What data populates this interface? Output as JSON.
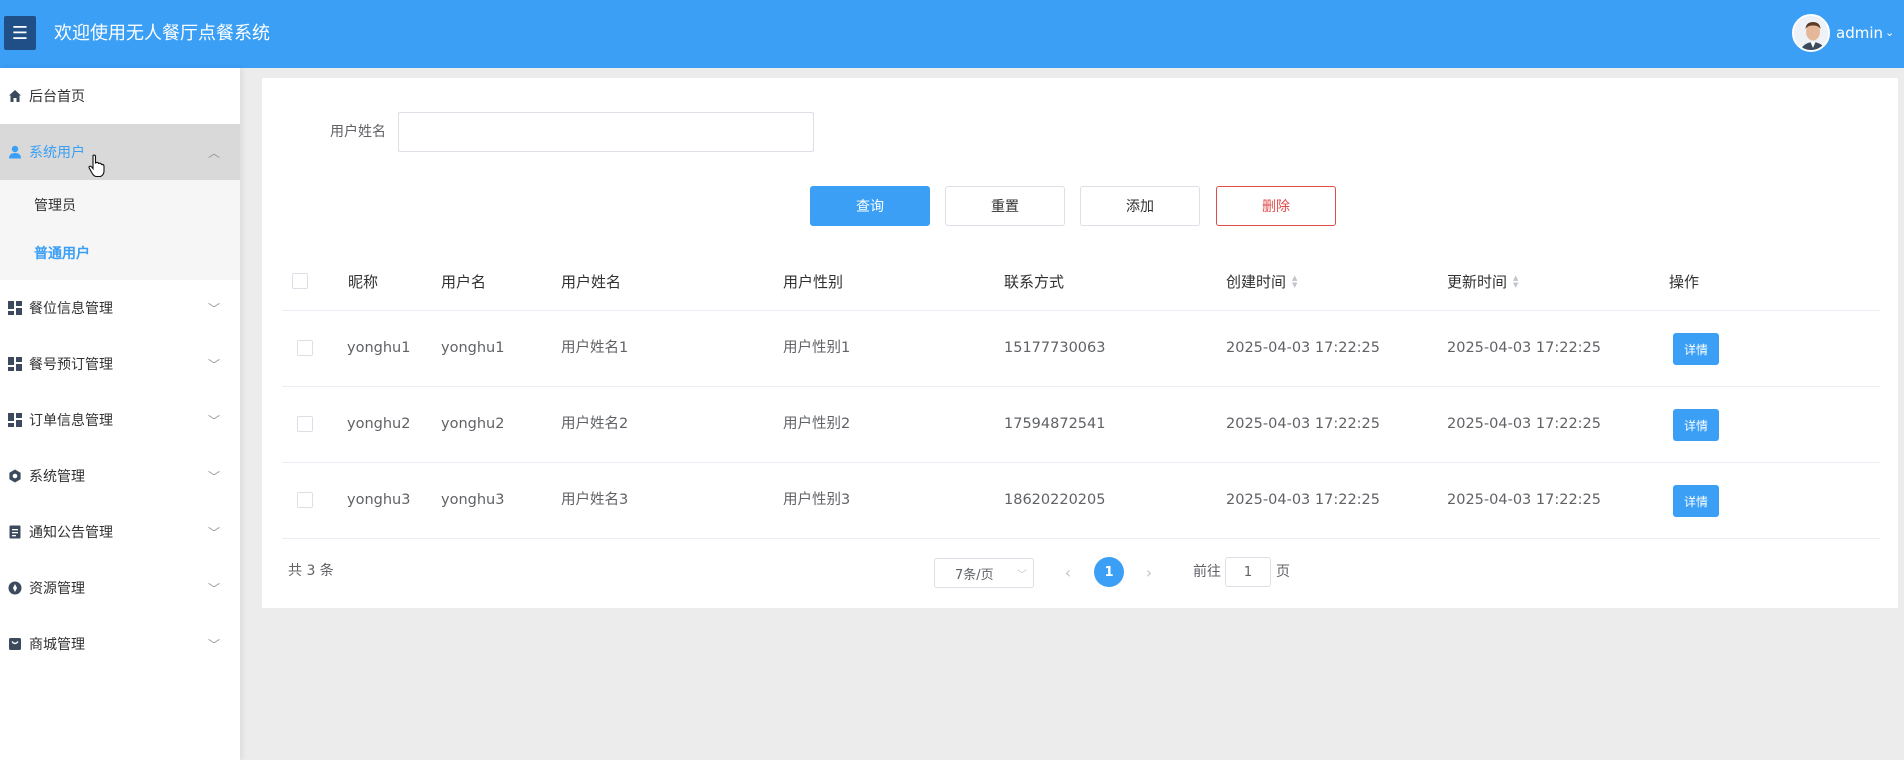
{
  "header": {
    "menu_icon": "hamburger-icon",
    "title": "欢迎使用无人餐厅点餐系统",
    "user": "admin"
  },
  "sidebar": {
    "items": [
      {
        "label": "后台首页",
        "icon": "home-icon"
      },
      {
        "label": "系统用户",
        "icon": "user-icon",
        "expanded": true
      },
      {
        "label": "餐位信息管理",
        "icon": "grid-icon"
      },
      {
        "label": "餐号预订管理",
        "icon": "grid-icon"
      },
      {
        "label": "订单信息管理",
        "icon": "grid-icon"
      },
      {
        "label": "系统管理",
        "icon": "gear-icon"
      },
      {
        "label": "通知公告管理",
        "icon": "document-icon"
      },
      {
        "label": "资源管理",
        "icon": "compass-icon"
      },
      {
        "label": "商城管理",
        "icon": "shop-icon"
      }
    ],
    "sub_items": [
      {
        "label": "管理员",
        "active": false
      },
      {
        "label": "普通用户",
        "active": true
      }
    ]
  },
  "search": {
    "label": "用户姓名",
    "value": "",
    "placeholder": ""
  },
  "toolbar": {
    "query_label": "查询",
    "reset_label": "重置",
    "add_label": "添加",
    "delete_label": "删除"
  },
  "table": {
    "headers": [
      "昵称",
      "用户名",
      "用户姓名",
      "用户性别",
      "联系方式",
      "创建时间",
      "更新时间",
      "操作"
    ],
    "rows": [
      {
        "nickname": "yonghu1",
        "username": "yonghu1",
        "realname": "用户姓名1",
        "gender": "用户性别1",
        "phone": "15177730063",
        "created": "2025-04-03 17:22:25",
        "updated": "2025-04-03 17:22:25",
        "action": "详情"
      },
      {
        "nickname": "yonghu2",
        "username": "yonghu2",
        "realname": "用户姓名2",
        "gender": "用户性别2",
        "phone": "17594872541",
        "created": "2025-04-03 17:22:25",
        "updated": "2025-04-03 17:22:25",
        "action": "详情"
      },
      {
        "nickname": "yonghu3",
        "username": "yonghu3",
        "realname": "用户姓名3",
        "gender": "用户性别3",
        "phone": "18620220205",
        "created": "2025-04-03 17:22:25",
        "updated": "2025-04-03 17:22:25",
        "action": "详情"
      }
    ]
  },
  "pagination": {
    "total_text": "共 3 条",
    "page_size": "7条/页",
    "current_page": "1",
    "goto_label": "前往",
    "goto_value": "1",
    "goto_suffix": "页"
  },
  "colors": {
    "primary": "#3a9ff5",
    "danger": "#e24a4a",
    "menu_toggle": "#1f4f86"
  }
}
